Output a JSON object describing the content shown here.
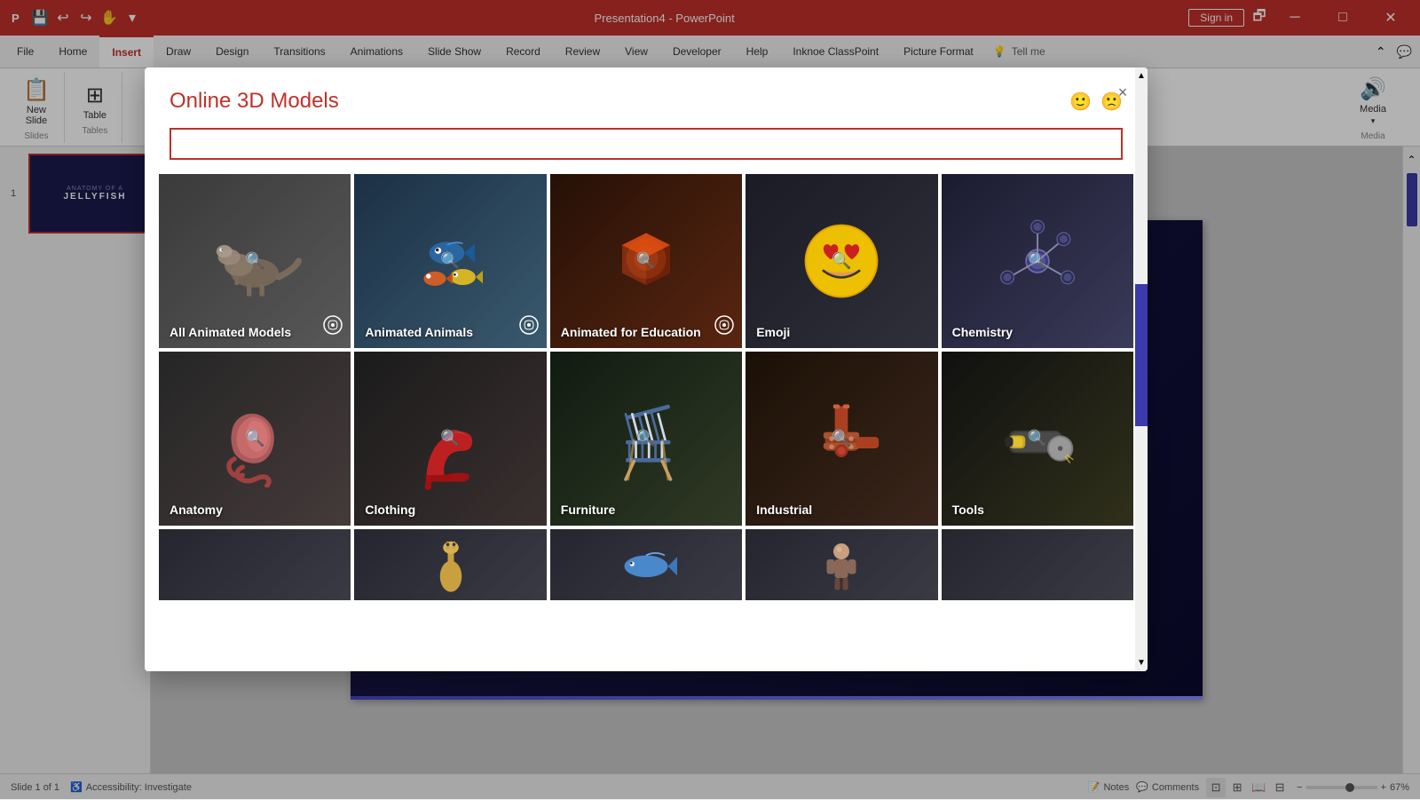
{
  "app": {
    "title": "Presentation4 - PowerPoint",
    "sign_in": "Sign in"
  },
  "titlebar": {
    "controls": [
      "minimize",
      "maximize",
      "close"
    ],
    "icons": [
      "save",
      "undo",
      "redo",
      "touch",
      "more"
    ]
  },
  "ribbon": {
    "tabs": [
      "File",
      "Home",
      "Insert",
      "Draw",
      "Design",
      "Transitions",
      "Animations",
      "Slide Show",
      "Record",
      "Review",
      "View",
      "Developer",
      "Help",
      "Inknoe ClassPoint",
      "Picture Format"
    ],
    "active_tab": "Insert",
    "tell_me": "Tell me",
    "groups": {
      "slides": {
        "label": "Slides",
        "buttons": [
          "New Slide"
        ]
      },
      "tables": {
        "label": "Tables",
        "buttons": [
          "Table"
        ]
      },
      "media": {
        "label": "Media",
        "buttons": [
          "Media"
        ]
      }
    }
  },
  "slide_panel": {
    "slide_number": "1",
    "thumbnail": {
      "title": "ANATOMY OF A",
      "subtitle": "JELLYFISH"
    }
  },
  "status_bar": {
    "slide_count": "Slide 1 of 1",
    "accessibility": "Accessibility: Investigate",
    "notes": "Notes",
    "comments": "Comments",
    "zoom": "67%"
  },
  "modal": {
    "title": "Online 3D Models",
    "search_placeholder": "",
    "close_label": "×",
    "feedback_icons": [
      "😊",
      "🙁"
    ],
    "categories": [
      {
        "id": "all-animated",
        "name": "All Animated Models",
        "has_animated_icon": true,
        "theme": "dino",
        "emoji": "🦕"
      },
      {
        "id": "animated-animals",
        "name": "Animated Animals",
        "has_animated_icon": true,
        "theme": "fish",
        "emoji": "🐠"
      },
      {
        "id": "animated-education",
        "name": "Animated for Education",
        "has_animated_icon": true,
        "theme": "education",
        "emoji": "🎓"
      },
      {
        "id": "emoji",
        "name": "Emoji",
        "has_animated_icon": false,
        "theme": "emoji",
        "emoji": "😍"
      },
      {
        "id": "chemistry",
        "name": "Chemistry",
        "has_animated_icon": false,
        "theme": "chemistry",
        "emoji": "⚗️"
      },
      {
        "id": "anatomy",
        "name": "Anatomy",
        "has_animated_icon": false,
        "theme": "anatomy",
        "emoji": "🫀"
      },
      {
        "id": "clothing",
        "name": "Clothing",
        "has_animated_icon": false,
        "theme": "clothing",
        "emoji": "👠"
      },
      {
        "id": "furniture",
        "name": "Furniture",
        "has_animated_icon": false,
        "theme": "furniture",
        "emoji": "🪑"
      },
      {
        "id": "industrial",
        "name": "Industrial",
        "has_animated_icon": false,
        "theme": "industrial",
        "emoji": "🔧"
      },
      {
        "id": "tools",
        "name": "Tools",
        "has_animated_icon": false,
        "theme": "tools",
        "emoji": "🔨"
      },
      {
        "id": "row3-1",
        "name": "",
        "has_animated_icon": false,
        "theme": "row3",
        "emoji": ""
      },
      {
        "id": "row3-2",
        "name": "",
        "has_animated_icon": false,
        "theme": "row3",
        "emoji": "🦒"
      },
      {
        "id": "row3-3",
        "name": "",
        "has_animated_icon": false,
        "theme": "row3",
        "emoji": "🐬"
      },
      {
        "id": "row3-4",
        "name": "",
        "has_animated_icon": false,
        "theme": "row3",
        "emoji": "👤"
      }
    ]
  }
}
